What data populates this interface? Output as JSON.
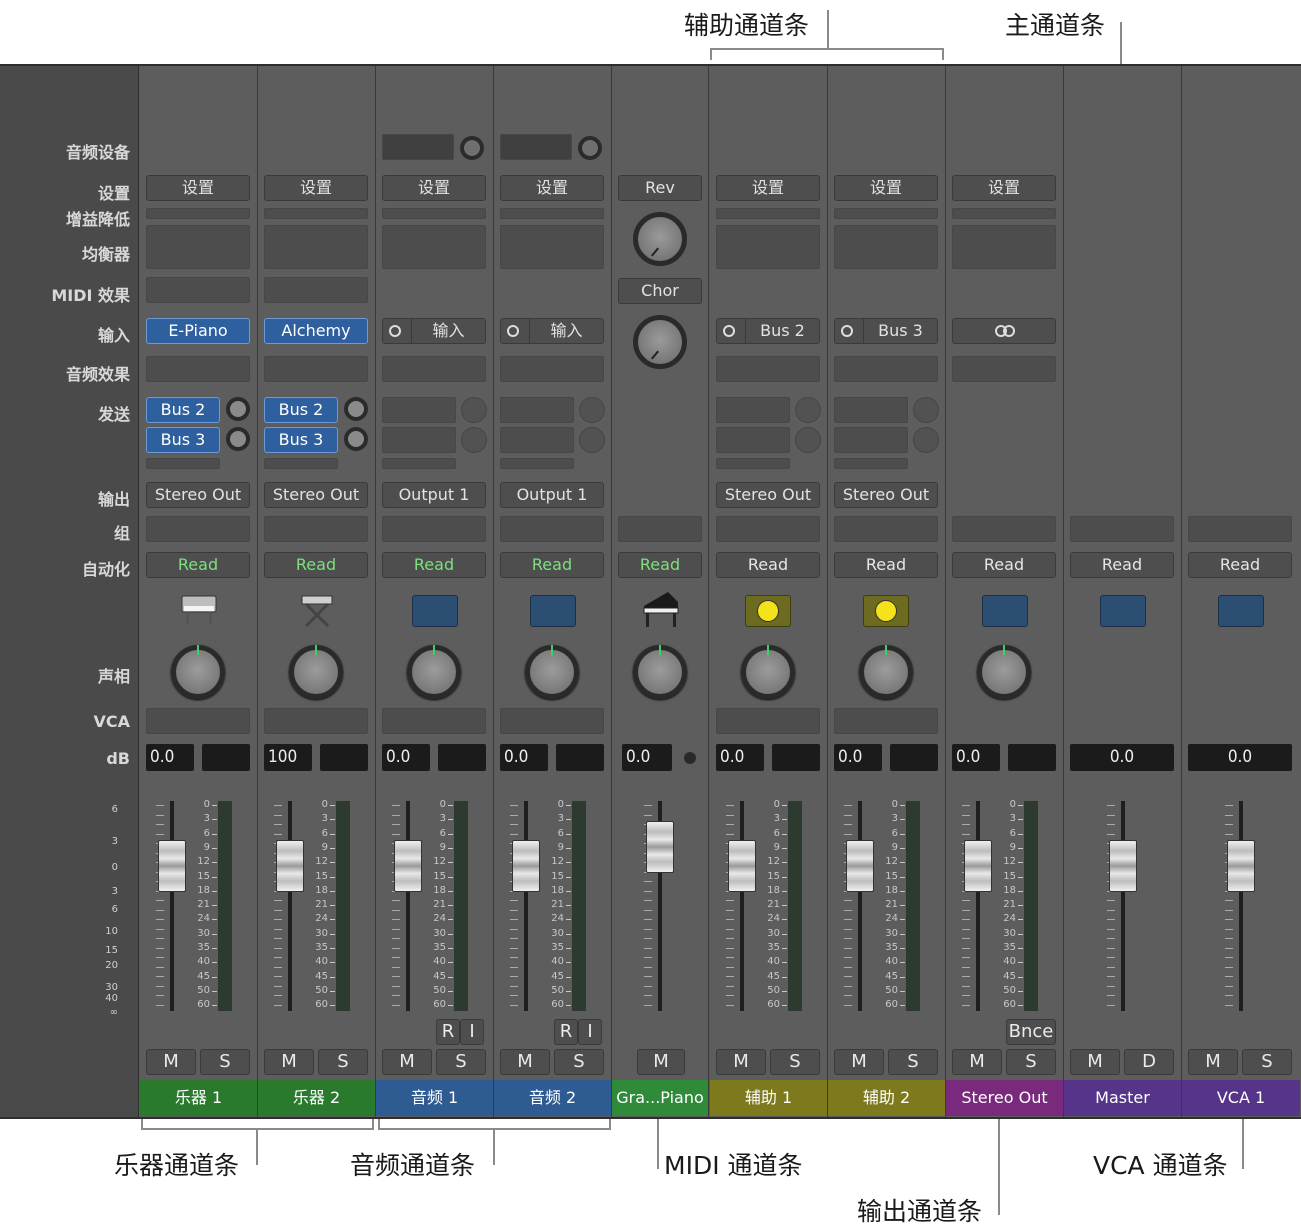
{
  "callouts": {
    "aux": "辅助通道条",
    "main": "主通道条",
    "instrument": "乐器通道条",
    "audio": "音频通道条",
    "midi": "MIDI 通道条",
    "vca": "VCA 通道条",
    "output": "输出通道条"
  },
  "rows": {
    "audio_device": "音频设备",
    "setting": "设置",
    "gain_reduction": "增益降低",
    "eq": "均衡器",
    "midi_fx": "MIDI 效果",
    "input": "输入",
    "audio_fx": "音频效果",
    "send": "发送",
    "output": "输出",
    "group": "组",
    "automation": "自动化",
    "pan": "声相",
    "vca": "VCA",
    "db": "dB"
  },
  "left_scale": [
    "6",
    "3",
    "0",
    "3",
    "6",
    "10",
    "15",
    "20",
    "30",
    "40",
    "∞"
  ],
  "meter_scale": [
    "0",
    "3",
    "6",
    "9",
    "12",
    "15",
    "18",
    "21",
    "24",
    "30",
    "35",
    "40",
    "45",
    "50",
    "60"
  ],
  "strips": [
    {
      "name": "乐器 1",
      "setting": "设置",
      "input": "E-Piano",
      "send1": "Bus 2",
      "send2": "Bus 3",
      "output": "Stereo Out",
      "automation": "Read",
      "db": "0.0",
      "mute": "M",
      "solo": "S",
      "color": "#2a7a2e",
      "icon": "electric-piano-icon",
      "fader_db": 0
    },
    {
      "name": "乐器 2",
      "setting": "设置",
      "input": "Alchemy",
      "send1": "Bus 2",
      "send2": "Bus 3",
      "output": "Stereo Out",
      "automation": "Read",
      "db": "100",
      "mute": "M",
      "solo": "S",
      "color": "#2a7a2e",
      "icon": "keyboard-stand-icon",
      "fader_db": 0
    },
    {
      "name": "音频 1",
      "setting": "设置",
      "input": "输入",
      "output": "Output 1",
      "automation": "Read",
      "db": "0.0",
      "mute": "M",
      "solo": "S",
      "rec": "R",
      "inmon": "I",
      "color": "#2e5b92",
      "icon": "waveform-icon",
      "fader_db": 0
    },
    {
      "name": "音频 2",
      "setting": "设置",
      "input": "输入",
      "output": "Output 1",
      "automation": "Read",
      "db": "0.0",
      "mute": "M",
      "solo": "S",
      "rec": "R",
      "inmon": "I",
      "color": "#2e5b92",
      "icon": "waveform-icon",
      "fader_db": 0
    },
    {
      "name": "Gra...Piano",
      "fx1": "Rev",
      "fx2": "Chor",
      "automation": "Read",
      "db": "0.0",
      "mute": "M",
      "color": "#2f8a3a",
      "icon": "grand-piano-icon",
      "fader_db": 0
    },
    {
      "name": "辅助 1",
      "setting": "设置",
      "input": "Bus 2",
      "output": "Stereo Out",
      "automation": "Read",
      "db": "0.0",
      "mute": "M",
      "solo": "S",
      "color": "#7d7a1e",
      "icon": "aux-meter-icon",
      "fader_db": 0
    },
    {
      "name": "辅助 2",
      "setting": "设置",
      "input": "Bus 3",
      "output": "Stereo Out",
      "automation": "Read",
      "db": "0.0",
      "mute": "M",
      "solo": "S",
      "color": "#7d7a1e",
      "icon": "aux-meter-icon",
      "fader_db": 0
    },
    {
      "name": "Stereo Out",
      "setting": "设置",
      "automation": "Read",
      "db": "0.0",
      "mute": "M",
      "solo": "S",
      "bounce": "Bnce",
      "color": "#7a2a7d",
      "icon": "waveform-icon",
      "fader_db": 0
    },
    {
      "name": "Master",
      "automation": "Read",
      "db": "0.0",
      "mute": "M",
      "dim": "D",
      "color": "#55348a",
      "icon": "waveform-icon",
      "fader_db": 0
    },
    {
      "name": "VCA 1",
      "automation": "Read",
      "db": "0.0",
      "mute": "M",
      "solo": "S",
      "color": "#55348a",
      "icon": "waveform-icon",
      "fader_db": 0
    }
  ]
}
